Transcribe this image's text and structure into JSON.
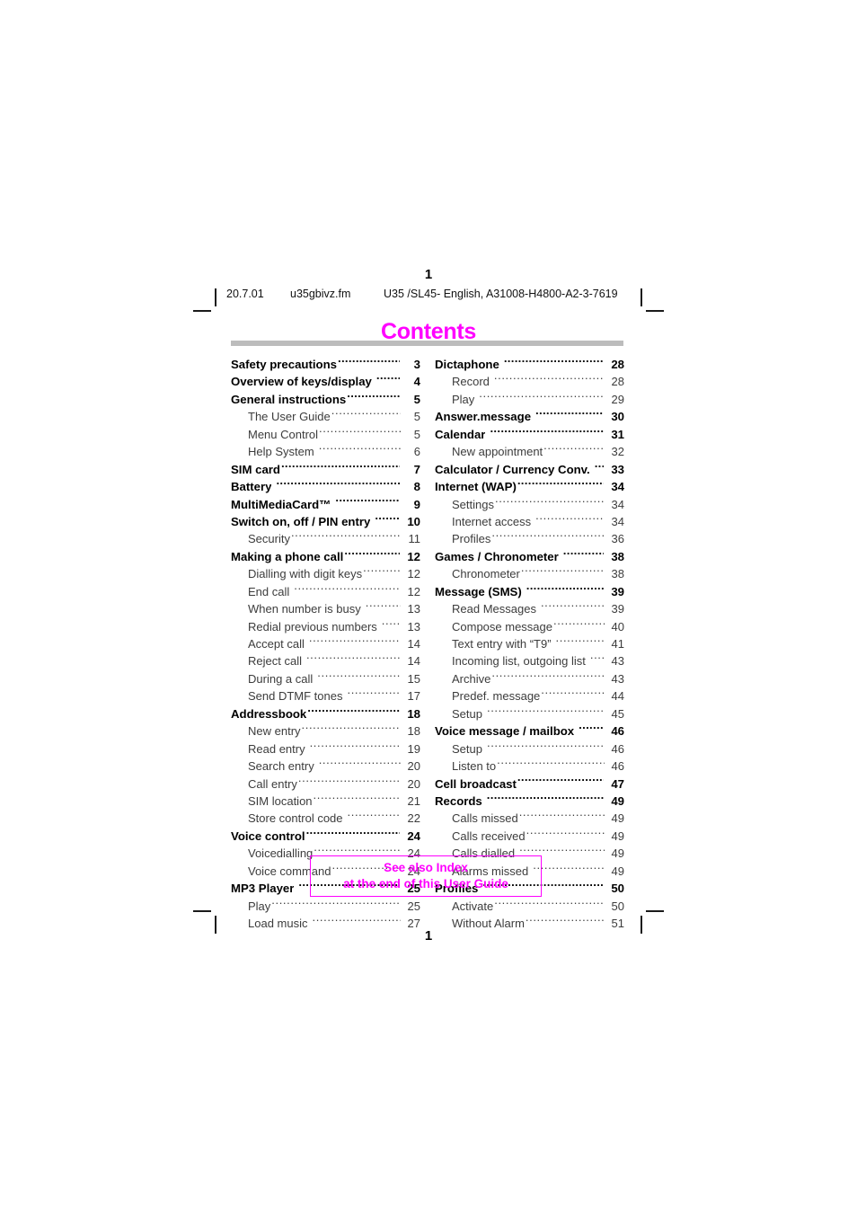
{
  "page": {
    "number_top": "1",
    "number_bottom": "1",
    "title": "Contents",
    "title_color": "#ff00ff",
    "rule_color": "#bcbcbc"
  },
  "running_header": {
    "date": "20.7.01",
    "filename": "u35gbivz.fm",
    "document_id": "U35 /SL45- English, A31008-H4800-A2-3-7619"
  },
  "toc": {
    "left_column": [
      {
        "label": "Safety precautions",
        "page": "3",
        "level": 1,
        "gap": false
      },
      {
        "label": "Overview of keys/display",
        "page": "4",
        "level": 1,
        "gap": true
      },
      {
        "label": "General instructions",
        "page": "5",
        "level": 1,
        "gap": false
      },
      {
        "label": "The User Guide",
        "page": "5",
        "level": 2,
        "gap": false
      },
      {
        "label": "Menu Control",
        "page": "5",
        "level": 2,
        "gap": false
      },
      {
        "label": "Help System",
        "page": "6",
        "level": 2,
        "gap": true
      },
      {
        "label": "SIM card",
        "page": "7",
        "level": 1,
        "gap": false
      },
      {
        "label": "Battery",
        "page": "8",
        "level": 1,
        "gap": true
      },
      {
        "label": "MultiMediaCard™",
        "page": "9",
        "level": 1,
        "gap": true
      },
      {
        "label": "Switch on, off / PIN entry",
        "page": "10",
        "level": 1,
        "gap": true
      },
      {
        "label": "Security",
        "page": "11",
        "level": 2,
        "gap": false
      },
      {
        "label": "Making a phone call",
        "page": "12",
        "level": 1,
        "gap": false
      },
      {
        "label": "Dialling with digit keys",
        "page": "12",
        "level": 2,
        "gap": false
      },
      {
        "label": "End call",
        "page": "12",
        "level": 2,
        "gap": true
      },
      {
        "label": "When number is busy",
        "page": "13",
        "level": 2,
        "gap": true
      },
      {
        "label": "Redial previous numbers",
        "page": "13",
        "level": 2,
        "gap": true
      },
      {
        "label": "Accept call",
        "page": "14",
        "level": 2,
        "gap": true
      },
      {
        "label": "Reject call",
        "page": "14",
        "level": 2,
        "gap": true
      },
      {
        "label": "During a call",
        "page": "15",
        "level": 2,
        "gap": true
      },
      {
        "label": "Send DTMF tones",
        "page": "17",
        "level": 2,
        "gap": true
      },
      {
        "label": "Addressbook",
        "page": "18",
        "level": 1,
        "gap": false
      },
      {
        "label": "New entry",
        "page": "18",
        "level": 2,
        "gap": false
      },
      {
        "label": "Read entry",
        "page": "19",
        "level": 2,
        "gap": true
      },
      {
        "label": "Search entry",
        "page": "20",
        "level": 2,
        "gap": true
      },
      {
        "label": "Call entry",
        "page": "20",
        "level": 2,
        "gap": false
      },
      {
        "label": "SIM location",
        "page": "21",
        "level": 2,
        "gap": false
      },
      {
        "label": "Store control code",
        "page": "22",
        "level": 2,
        "gap": true
      },
      {
        "label": "Voice control",
        "page": "24",
        "level": 1,
        "gap": false
      },
      {
        "label": "Voicedialling",
        "page": "24",
        "level": 2,
        "gap": false
      },
      {
        "label": "Voice command",
        "page": "24",
        "level": 2,
        "gap": false
      },
      {
        "label": "MP3 Player",
        "page": "25",
        "level": 1,
        "gap": true
      },
      {
        "label": "Play",
        "page": "25",
        "level": 2,
        "gap": false
      },
      {
        "label": "Load music",
        "page": "27",
        "level": 2,
        "gap": true
      }
    ],
    "right_column": [
      {
        "label": "Dictaphone",
        "page": "28",
        "level": 1,
        "gap": true
      },
      {
        "label": "Record",
        "page": "28",
        "level": 2,
        "gap": true
      },
      {
        "label": "Play",
        "page": "29",
        "level": 2,
        "gap": true
      },
      {
        "label": "Answer.message",
        "page": "30",
        "level": 1,
        "gap": true
      },
      {
        "label": "Calendar",
        "page": "31",
        "level": 1,
        "gap": true
      },
      {
        "label": "New appointment",
        "page": "32",
        "level": 2,
        "gap": false
      },
      {
        "label": "Calculator / Currency Conv.",
        "page": "33",
        "level": 1,
        "gap": true
      },
      {
        "label": "Internet (WAP)",
        "page": "34",
        "level": 1,
        "gap": false
      },
      {
        "label": "Settings",
        "page": "34",
        "level": 2,
        "gap": false
      },
      {
        "label": "Internet access",
        "page": "34",
        "level": 2,
        "gap": true
      },
      {
        "label": "Profiles",
        "page": "36",
        "level": 2,
        "gap": false
      },
      {
        "label": "Games / Chronometer",
        "page": "38",
        "level": 1,
        "gap": true
      },
      {
        "label": "Chronometer",
        "page": "38",
        "level": 2,
        "gap": false
      },
      {
        "label": "Message (SMS)",
        "page": "39",
        "level": 1,
        "gap": true
      },
      {
        "label": "Read Messages",
        "page": "39",
        "level": 2,
        "gap": true
      },
      {
        "label": "Compose message",
        "page": "40",
        "level": 2,
        "gap": false
      },
      {
        "label": "Text entry with “T9”",
        "page": "41",
        "level": 2,
        "gap": true
      },
      {
        "label": "Incoming list, outgoing list",
        "page": "43",
        "level": 2,
        "gap": true
      },
      {
        "label": "Archive",
        "page": "43",
        "level": 2,
        "gap": false
      },
      {
        "label": "Predef. message",
        "page": "44",
        "level": 2,
        "gap": false
      },
      {
        "label": "Setup",
        "page": "45",
        "level": 2,
        "gap": true
      },
      {
        "label": "Voice message / mailbox",
        "page": "46",
        "level": 1,
        "gap": true
      },
      {
        "label": "Setup",
        "page": "46",
        "level": 2,
        "gap": true
      },
      {
        "label": "Listen to",
        "page": "46",
        "level": 2,
        "gap": false
      },
      {
        "label": "Cell broadcast",
        "page": "47",
        "level": 1,
        "gap": false
      },
      {
        "label": "Records",
        "page": "49",
        "level": 1,
        "gap": true
      },
      {
        "label": "Calls missed",
        "page": "49",
        "level": 2,
        "gap": false
      },
      {
        "label": "Calls received",
        "page": "49",
        "level": 2,
        "gap": false
      },
      {
        "label": "Calls dialled",
        "page": "49",
        "level": 2,
        "gap": true
      },
      {
        "label": "Alarms missed",
        "page": "49",
        "level": 2,
        "gap": true
      },
      {
        "label": "Profiles",
        "page": "50",
        "level": 1,
        "gap": true
      },
      {
        "label": "Activate",
        "page": "50",
        "level": 2,
        "gap": false
      },
      {
        "label": "Without Alarm",
        "page": "51",
        "level": 2,
        "gap": false
      }
    ]
  },
  "see_also": {
    "line1": "See also Index",
    "line2": "at the end of this User Guide",
    "color": "#ff00ff"
  }
}
